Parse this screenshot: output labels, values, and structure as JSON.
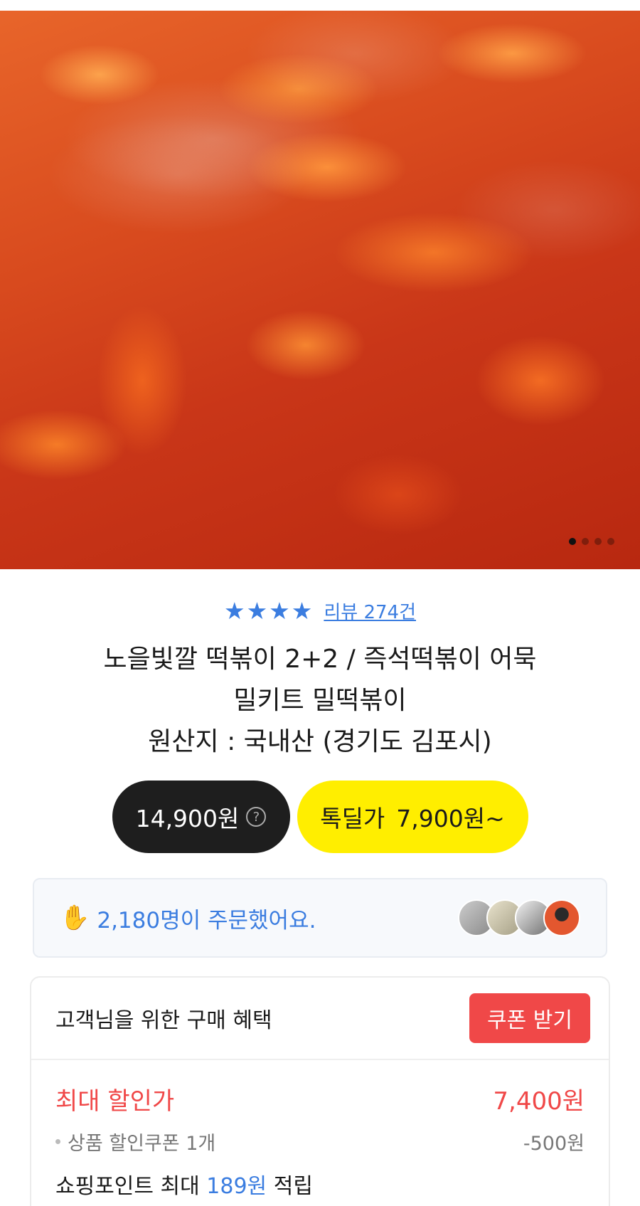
{
  "hero": {
    "image_alt": "떡볶이",
    "slide_count": 4,
    "active_slide": 1
  },
  "rating": {
    "stars": 4,
    "review_link": "리뷰 274건",
    "star_color": "#3b7de0"
  },
  "product": {
    "title_line1": "노을빛깔 떡볶이 2+2 / 즉석떡볶이 어묵",
    "title_line2": "밀키트 밀떡볶이",
    "origin": "원산지 : 국내산 (경기도 김포시)"
  },
  "price": {
    "original": "14,900원",
    "help_icon": "?",
    "deal_label": "톡딜가",
    "deal_price": "7,900원~",
    "deal_color": "#ffee00"
  },
  "orders": {
    "icon": "hand-wave-icon",
    "text": "2,180명이 주문했어요."
  },
  "benefit": {
    "title": "고객님을 위한 구매 혜택",
    "coupon_button": "쿠폰 받기",
    "max_label": "최대 할인가",
    "max_value": "7,400원",
    "coupon_item": "상품 할인쿠폰 1개",
    "coupon_discount": "-500원",
    "points_prefix": "쇼핑포인트 최대",
    "points_value": "189원",
    "points_suffix": "적립",
    "accent_color": "#f04848"
  }
}
